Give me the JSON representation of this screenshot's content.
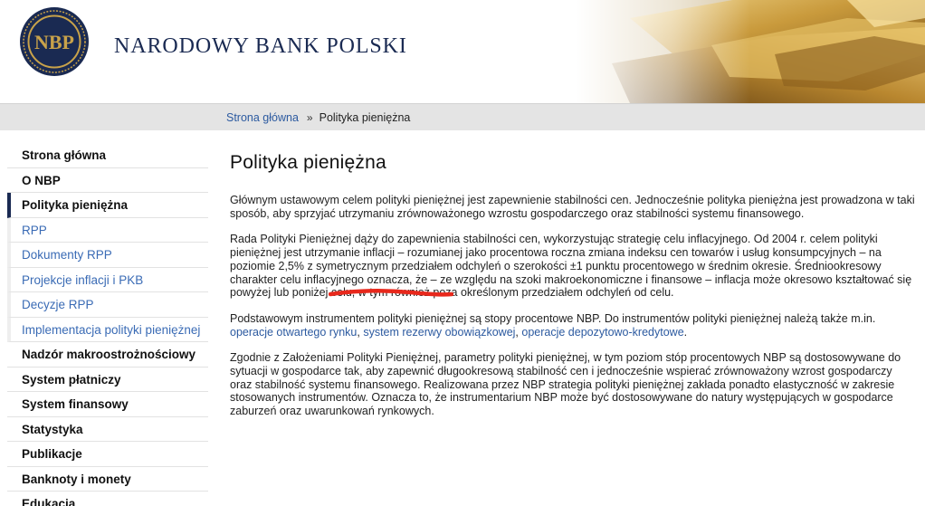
{
  "header": {
    "brand": "NARODOWY BANK POLSKI",
    "logo_text": "NBP"
  },
  "breadcrumb": {
    "home": "Strona główna",
    "separator": "»",
    "current": "Polityka pieniężna"
  },
  "sidebar": {
    "items": [
      {
        "label": "Strona główna"
      },
      {
        "label": "O NBP"
      },
      {
        "label": "Polityka pieniężna"
      },
      {
        "label": "RPP"
      },
      {
        "label": "Dokumenty RPP"
      },
      {
        "label": "Projekcje inflacji i PKB"
      },
      {
        "label": "Decyzje RPP"
      },
      {
        "label": "Implementacja polityki pieniężnej"
      },
      {
        "label": "Nadzór makroostrożnościowy"
      },
      {
        "label": "System płatniczy"
      },
      {
        "label": "System finansowy"
      },
      {
        "label": "Statystyka"
      },
      {
        "label": "Publikacje"
      },
      {
        "label": "Banknoty i monety"
      },
      {
        "label": "Edukacja"
      }
    ]
  },
  "main": {
    "title": "Polityka pieniężna",
    "p1": "Głównym ustawowym celem polityki pieniężnej jest zapewnienie stabilności cen. Jednocześnie polityka pieniężna jest prowadzona w taki sposób, aby sprzyjać utrzymaniu zrównoważonego wzrostu gospodarczego oraz stabilności systemu finansowego.",
    "p2": "Rada Polityki Pieniężnej dąży do zapewnienia stabilności cen, wykorzystując strategię celu inflacyjnego. Od 2004 r. celem polityki pieniężnej jest utrzymanie inflacji – rozumianej jako procentowa roczna zmiana indeksu cen towarów i usług konsumpcyjnych – na poziomie 2,5% z symetrycznym przedziałem odchyleń o szerokości ±1 punktu procentowego w średnim okresie. Średniookresowy charakter celu inflacyjnego oznacza, że – ze względu na szoki makroekonomiczne i finansowe – inflacja może okresowo kształtować się powyżej lub poniżej celu, w tym również poza określonym przedziałem odchyleń od celu.",
    "p3_text": "Podstawowym instrumentem polityki pieniężnej są stopy procentowe NBP. Do instrumentów polityki pieniężnej należą także m.in. ",
    "p3_links": [
      "operacje otwartego rynku",
      "system rezerwy obowiązkowej",
      "operacje depozytowo-kredytowe"
    ],
    "p3_sep": ", ",
    "p3_end": ".",
    "p4": "Zgodnie z Założeniami Polityki Pieniężnej, parametry polityki pieniężnej, w tym poziom stóp procentowych NBP są dostosowywane do sytuacji w gospodarce tak, aby zapewnić długookresową stabilność cen i jednocześnie wspierać zrównoważony wzrost gospodarczy oraz stabilność systemu finansowego. Realizowana przez NBP strategia polityki pieniężnej zakłada ponadto elastyczność w zakresie stosowanych instrumentów. Oznacza to, że instrumentarium NBP może być dostosowywane do natury występujących w gospodarce zaburzeń oraz uwarunkowań rynkowych."
  },
  "colors": {
    "navy": "#1a2a52",
    "gold": "#c8a24a",
    "link": "#2c5aa0",
    "underline_mark": "#e8281c"
  }
}
